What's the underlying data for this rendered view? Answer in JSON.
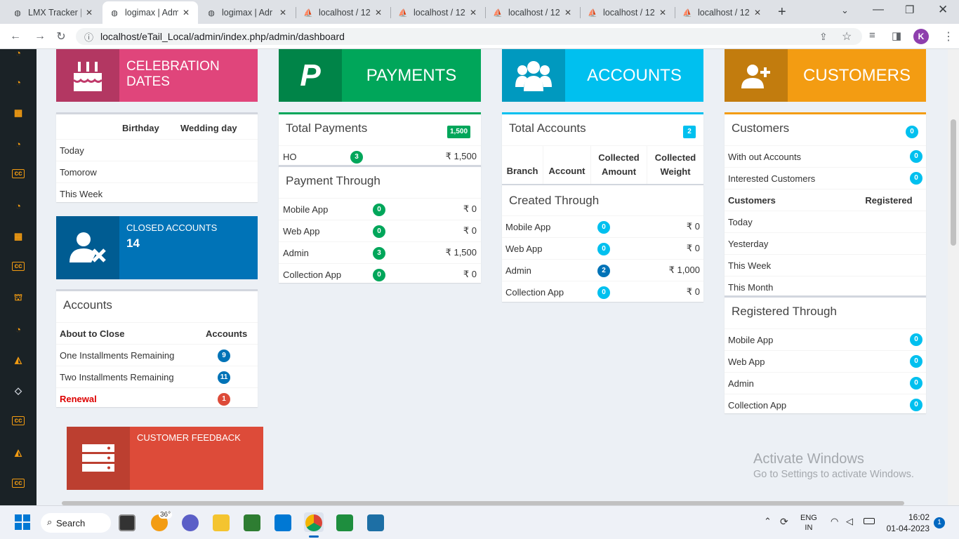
{
  "browser": {
    "tabs": [
      {
        "title": "LMX Tracker |",
        "icon": "globe-icon"
      },
      {
        "title": "logimax | Adm",
        "icon": "globe-icon"
      },
      {
        "title": "logimax | Adr",
        "icon": "globe-icon"
      },
      {
        "title": "localhost / 12",
        "icon": "phpmyadmin-icon"
      },
      {
        "title": "localhost / 12",
        "icon": "phpmyadmin-icon"
      },
      {
        "title": "localhost / 12",
        "icon": "phpmyadmin-icon"
      },
      {
        "title": "localhost / 12",
        "icon": "phpmyadmin-icon"
      },
      {
        "title": "localhost / 12",
        "icon": "phpmyadmin-icon"
      }
    ],
    "url": "localhost/eTail_Local/admin/index.php/admin/dashboard",
    "profile_initial": "K"
  },
  "celebration": {
    "title": "CELEBRATION DATES",
    "col_birthday": "Birthday",
    "col_wedding": "Wedding day",
    "rows": [
      "Today",
      "Tomorow",
      "This Week"
    ]
  },
  "payments_box": {
    "title": "PAYMENTS"
  },
  "accounts_box": {
    "title": "ACCOUNTS"
  },
  "customers_box": {
    "title": "CUSTOMERS"
  },
  "closed_accounts": {
    "label": "CLOSED ACCOUNTS",
    "value": "14"
  },
  "accounts_panel": {
    "title": "Accounts",
    "col_about": "About to Close",
    "col_accounts": "Accounts",
    "rows": [
      {
        "label": "One Installments Remaining",
        "count": "9"
      },
      {
        "label": "Two Installments Remaining",
        "count": "11"
      },
      {
        "label": "Renewal",
        "count": "1"
      }
    ]
  },
  "total_payments": {
    "title": "Total Payments",
    "total": "1,500",
    "rows": [
      {
        "label": "HO",
        "count": "3",
        "amount": "₹ 1,500"
      }
    ]
  },
  "payment_through": {
    "title": "Payment Through",
    "rows": [
      {
        "label": "Mobile App",
        "count": "0",
        "amount": "₹ 0"
      },
      {
        "label": "Web App",
        "count": "0",
        "amount": "₹ 0"
      },
      {
        "label": "Admin",
        "count": "3",
        "amount": "₹ 1,500"
      },
      {
        "label": "Collection App",
        "count": "0",
        "amount": "₹ 0"
      }
    ]
  },
  "total_accounts": {
    "title": "Total Accounts",
    "total": "2",
    "columns": [
      "Branch",
      "Account",
      "Collected Amount",
      "Collected Weight"
    ]
  },
  "created_through": {
    "title": "Created Through",
    "rows": [
      {
        "label": "Mobile App",
        "count": "0",
        "amount": "₹ 0"
      },
      {
        "label": "Web App",
        "count": "0",
        "amount": "₹ 0"
      },
      {
        "label": "Admin",
        "count": "2",
        "amount": "₹ 1,000"
      },
      {
        "label": "Collection App",
        "count": "0",
        "amount": "₹ 0"
      }
    ]
  },
  "customers_panel": {
    "title": "Customers",
    "total": "0",
    "rows": [
      {
        "label": "With out Accounts",
        "count": "0"
      },
      {
        "label": "Interested Customers",
        "count": "0"
      }
    ],
    "col_customers": "Customers",
    "col_registered": "Registered",
    "periods": [
      "Today",
      "Yesterday",
      "This Week",
      "This Month"
    ]
  },
  "registered_through": {
    "title": "Registered Through",
    "rows": [
      {
        "label": "Mobile App",
        "count": "0"
      },
      {
        "label": "Web App",
        "count": "0"
      },
      {
        "label": "Admin",
        "count": "0"
      },
      {
        "label": "Collection App",
        "count": "0"
      }
    ]
  },
  "feedback": {
    "label": "CUSTOMER FEEDBACK"
  },
  "watermark": {
    "line1": "Activate Windows",
    "line2": "Go to Settings to activate Windows."
  },
  "taskbar": {
    "search_label": "Search",
    "weather": "36°",
    "lang1": "ENG",
    "lang2": "IN",
    "time": "16:02",
    "date": "01-04-2023",
    "notif_count": "1"
  },
  "colors": {
    "pink": "#e0457b",
    "green": "#00a65a",
    "sky": "#00c0ef",
    "orange": "#f39c12",
    "blue": "#0073b7",
    "red": "#dd4b39"
  }
}
